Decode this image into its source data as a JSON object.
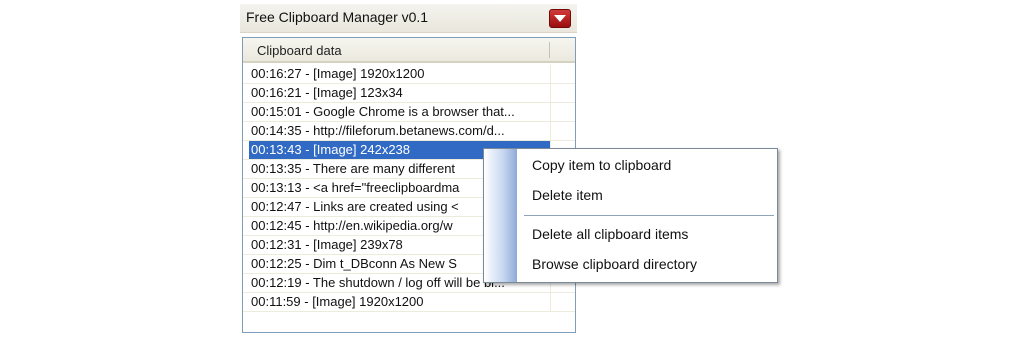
{
  "window": {
    "title": "Free Clipboard Manager v0.1",
    "menu_button_icon": "chevron-down-icon",
    "menu_button_color": "#b51a1a"
  },
  "list": {
    "column_header": "Clipboard data",
    "rows": [
      "00:16:27 - [Image] 1920x1200",
      "00:16:21 - [Image] 123x34",
      "00:15:01 - Google Chrome is a browser that...",
      "00:14:35 - http://fileforum.betanews.com/d...",
      "00:13:43 - [Image] 242x238",
      "00:13:35 - There are many different",
      "00:13:13 - <a href=\"freeclipboardma",
      "00:12:47 - Links are created using <",
      "00:12:45 - http://en.wikipedia.org/w",
      "00:12:31 - [Image] 239x78",
      "00:12:25 - Dim t_DBconn As New S",
      "00:12:19 - The shutdown / log off will be bl...",
      "00:11:59 - [Image] 1920x1200"
    ],
    "selected_index": 4,
    "selection_color": "#316ac5"
  },
  "context_menu": {
    "items": [
      "Copy item to clipboard",
      "Delete item",
      "Delete all clipboard items",
      "Browse clipboard directory"
    ]
  }
}
